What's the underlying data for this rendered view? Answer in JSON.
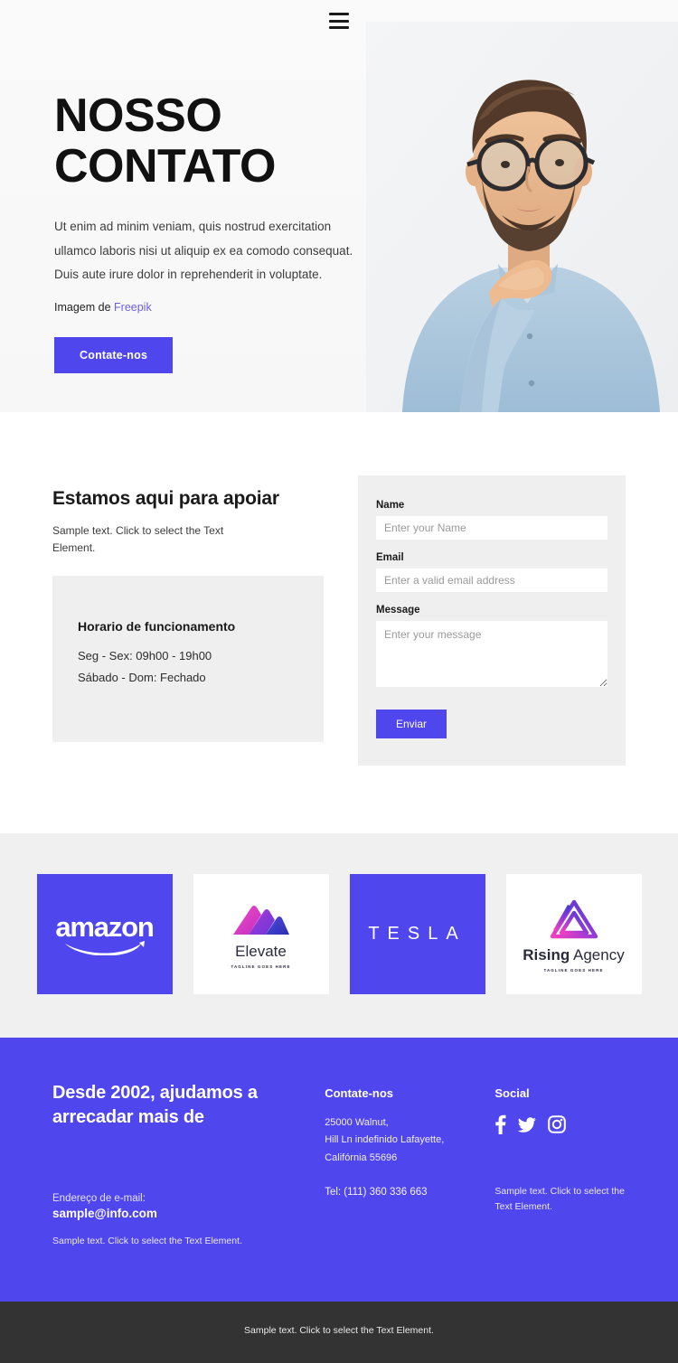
{
  "nav": {
    "menu_icon": "hamburger-menu-icon"
  },
  "hero": {
    "title_line1": "NOSSO",
    "title_line2": "CONTATO",
    "description": "Ut enim ad minim veniam, quis nostrud exercitation ullamco laboris nisi ut aliquip ex ea comodo consequat. Duis aute irure dolor in reprehenderit in voluptate.",
    "credit_prefix": "Imagem de ",
    "credit_link": "Freepik",
    "cta_label": "Contate-nos",
    "image_alt": "man-with-glasses-thinking-photo",
    "accent_color": "#5046ed"
  },
  "contact": {
    "heading": "Estamos aqui para apoiar",
    "subtext": "Sample text. Click to select the Text Element.",
    "hours": {
      "title": "Horario de funcionamento",
      "line1": "Seg - Sex: 09h00 - 19h00",
      "line2": "Sábado - Dom: Fechado"
    },
    "form": {
      "name_label": "Name",
      "name_placeholder": "Enter your Name",
      "email_label": "Email",
      "email_placeholder": "Enter a valid email address",
      "message_label": "Message",
      "message_placeholder": "Enter your message",
      "submit_label": "Enviar",
      "name_value": "",
      "email_value": "",
      "message_value": ""
    }
  },
  "logos": [
    {
      "name": "amazon",
      "wordmark": "amazon",
      "style": "purple"
    },
    {
      "name": "elevate",
      "wordmark": "Elevate",
      "tagline": "TAGLINE GOES HERE",
      "style": "white"
    },
    {
      "name": "tesla",
      "wordmark": "TESLA",
      "style": "purple"
    },
    {
      "name": "rising-agency",
      "wordmark_bold": "Rising",
      "wordmark_light": " Agency",
      "tagline": "TAGLINE GOES HERE",
      "style": "white"
    }
  ],
  "footer": {
    "heading": "Desde 2002, ajudamos a arrecadar mais de",
    "email_label": "Endereço de e-mail:",
    "email": "sample@info.com",
    "note": "Sample text. Click to select the Text Element.",
    "contact_title": "Contate-nos",
    "address_line1": "25000 Walnut,",
    "address_line2": "Hill Ln indefinido Lafayette,",
    "address_line3": "Califórnia 55696",
    "tel": "Tel:  (111) 360 336 663",
    "social_title": "Social",
    "social_icons": [
      "facebook-icon",
      "twitter-icon",
      "instagram-icon"
    ],
    "social_note": "Sample text. Click to select the Text Element.",
    "background_color": "#5046ed"
  },
  "bottombar": {
    "text": "Sample text. Click to select the Text Element.",
    "background_color": "#333333"
  }
}
